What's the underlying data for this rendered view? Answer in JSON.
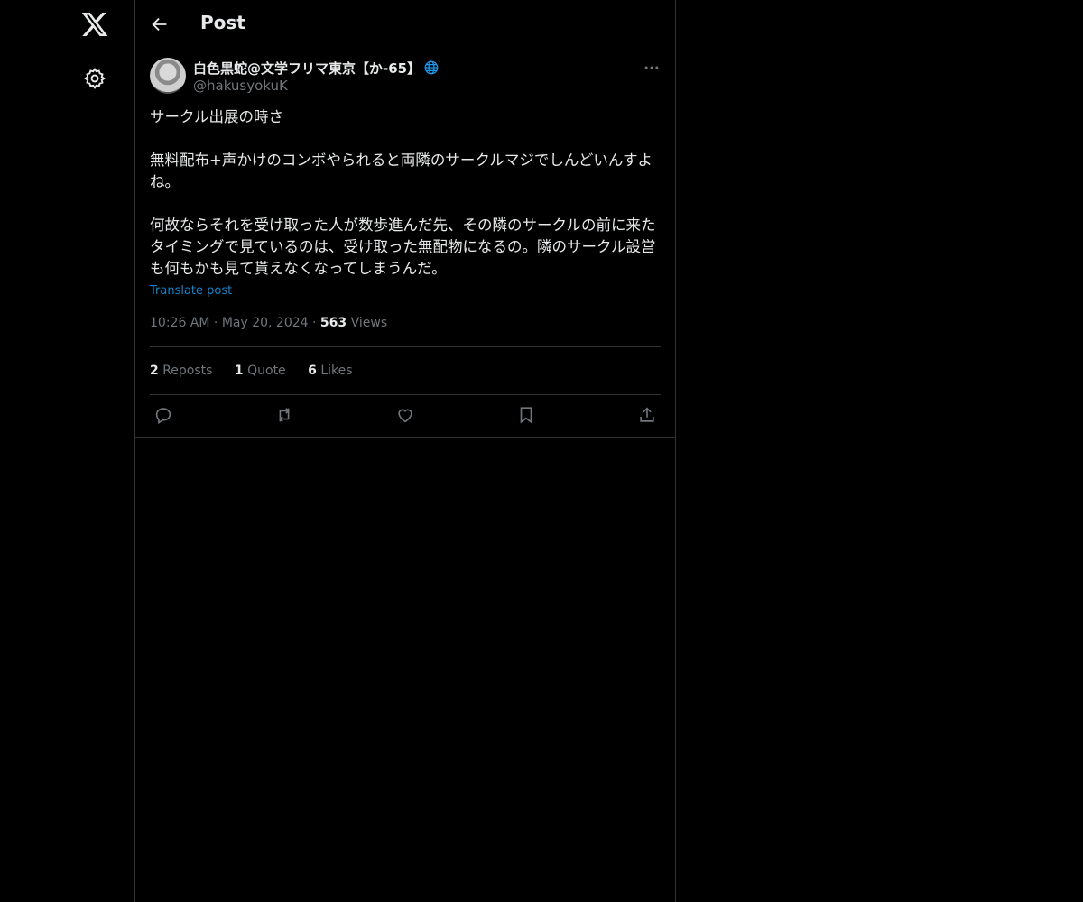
{
  "sidebar": {
    "logo_icon": "x-logo-icon",
    "settings_icon": "gear-icon"
  },
  "header": {
    "back_icon": "arrow-left-icon",
    "title": "Post"
  },
  "post": {
    "author_name": "白色黒蛇@文学フリマ東京【か-65】",
    "handle": "@hakusyokuK",
    "paragraphs": [
      "サークル出展の時さ",
      "無料配布+声かけのコンボやられると両隣のサークルマジでしんどいんすよね。",
      "何故ならそれを受け取った人が数歩進んだ先、その隣のサークルの前に来たタイミングで見ているのは、受け取った無配物になるの。隣のサークル設営も何もかも見て貰えなくなってしまうんだ。"
    ],
    "translate_label": "Translate post",
    "time": "10:26 AM",
    "date": "May 20, 2024",
    "separator": "·",
    "views_count": "563",
    "views_label": "Views",
    "reposts_count": "2",
    "reposts_label": "Reposts",
    "quotes_count": "1",
    "quotes_label": "Quote",
    "likes_count": "6",
    "likes_label": "Likes"
  },
  "colors": {
    "background": "#000000",
    "text": "#e7e9ea",
    "muted": "#71767b",
    "link": "#1d9bf0",
    "border": "#2f3336"
  }
}
